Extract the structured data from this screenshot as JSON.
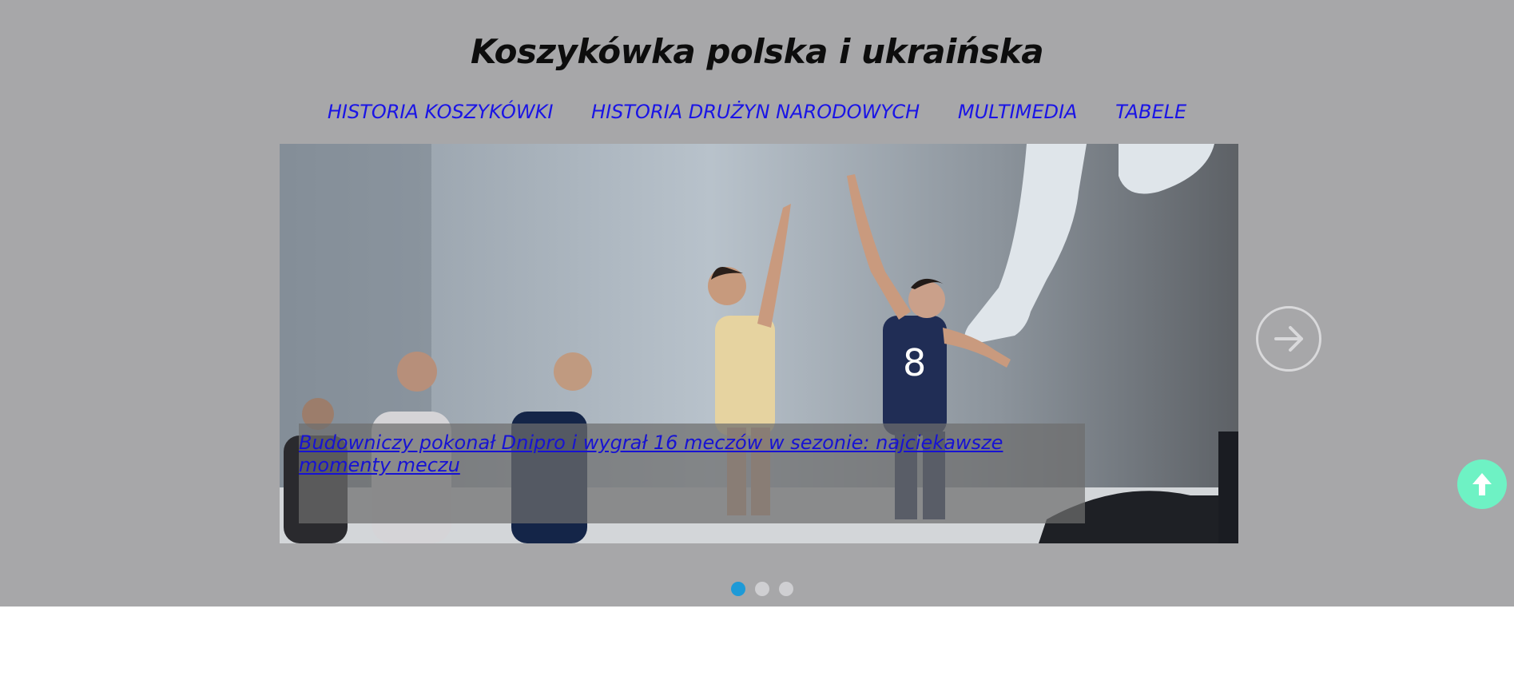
{
  "site": {
    "title": "Koszykówka polska i ukraińska"
  },
  "nav": {
    "items": [
      {
        "label": "HISTORIA KOSZYKÓWKI"
      },
      {
        "label": "HISTORIA DRUŻYN NARODOWYCH"
      },
      {
        "label": "MULTIMEDIA"
      },
      {
        "label": "TABELE"
      }
    ]
  },
  "slider": {
    "caption": "Budowniczy pokonał Dnipro i wygrał 16 meczów w sezonie: najciekawsze momenty meczu",
    "next_icon": "arrow-right-icon",
    "dots_total": 3,
    "active_dot": 1
  },
  "scroll_top": {
    "icon": "arrow-up-icon",
    "color": "#6ef2c4"
  },
  "colors": {
    "header_bg": "#a7a7a9",
    "link": "#1a14e6",
    "active_dot": "#1e9ad7"
  }
}
